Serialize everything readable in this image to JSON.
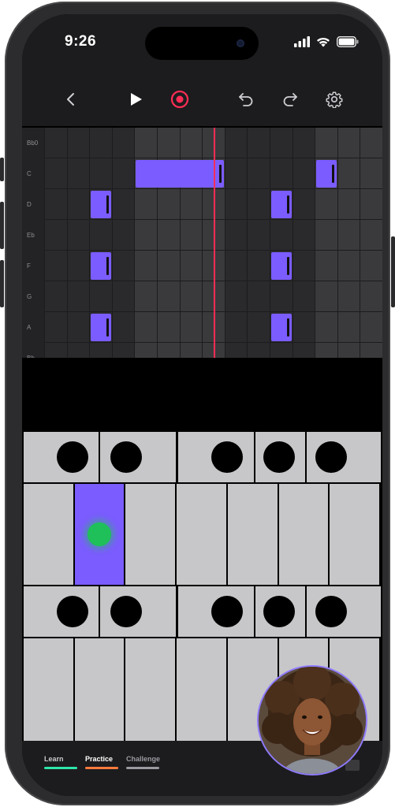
{
  "status": {
    "time": "9:26",
    "icons": [
      "cellular-signal-icon",
      "wifi-icon",
      "battery-icon"
    ]
  },
  "toolbar": {
    "buttons": [
      "back-icon",
      "play-icon",
      "record-icon",
      "undo-icon",
      "redo-icon",
      "settings-icon"
    ]
  },
  "colors": {
    "accent": "#7b5cff",
    "record": "#ff2d55",
    "playhead": "#ff2d55",
    "key": "#c7c7c9",
    "active_indicator": "#1fc05a",
    "learn": "#2ee6a8",
    "practice": "#ff7a3d",
    "challenge": "#9a9aa0"
  },
  "piano_roll": {
    "rows": [
      {
        "label": "Bb0"
      },
      {
        "label": "C"
      },
      {
        "label": "D"
      },
      {
        "label": "Eb"
      },
      {
        "label": "F"
      },
      {
        "label": "G"
      },
      {
        "label": "A"
      },
      {
        "label": "Bb"
      }
    ],
    "notes": [
      {
        "row": "C",
        "start_step": 4,
        "length_steps": 4
      },
      {
        "row": "C",
        "start_step": 12,
        "length_steps": 1
      },
      {
        "row": "D",
        "start_step": 2,
        "length_steps": 1
      },
      {
        "row": "D",
        "start_step": 10,
        "length_steps": 1
      },
      {
        "row": "F",
        "start_step": 2,
        "length_steps": 1
      },
      {
        "row": "F",
        "start_step": 10,
        "length_steps": 1
      },
      {
        "row": "A",
        "start_step": 2,
        "length_steps": 1
      },
      {
        "row": "A",
        "start_step": 10,
        "length_steps": 1
      }
    ],
    "steps": 16,
    "playhead_step": 7.5
  },
  "tabs": [
    {
      "label": "Learn"
    },
    {
      "label": "Practice"
    },
    {
      "label": "Challenge"
    }
  ],
  "avatar": {
    "description_icon": "user-avatar"
  }
}
